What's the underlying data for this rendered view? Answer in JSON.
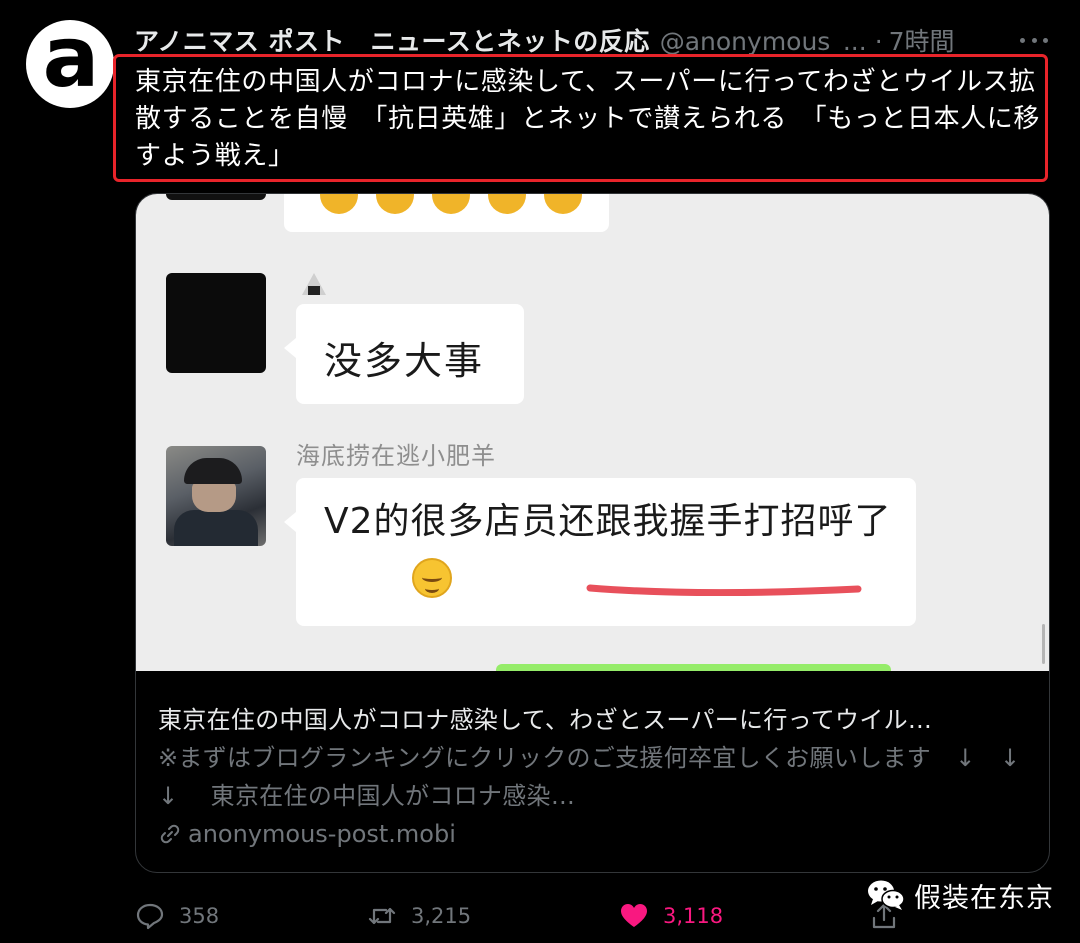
{
  "tweet": {
    "avatar_glyph": "a",
    "display_name": "アノニマス ポスト　ニュースとネットの反応",
    "handle": "@anonymous_...",
    "dot": "·",
    "time": "7時間",
    "text": "東京在住の中国人がコロナに感染して、スーパーに行ってわざとウイルス拡散することを自慢　「抗日英雄」とネットで讃えられる　「もっと日本人に移すよう戦え」",
    "highlight_color": "#e8242a"
  },
  "media": {
    "chat": {
      "message_1": "没多大事",
      "sender_name": "海底捞在逃小肥羊",
      "message_2": "V2的很多店员还跟我握手打招呼了"
    }
  },
  "link_card": {
    "title": "東京在住の中国人がコロナ感染して、わざとスーパーに行ってウイル…",
    "description": "※まずはブログランキングにクリックのご支援何卒宜しくお願いします　↓　↓　↓　 東京在住の中国人がコロナ感染…",
    "domain": "anonymous-post.mobi"
  },
  "actions": {
    "reply_count": "358",
    "retweet_count": "3,215",
    "like_count": "3,118",
    "like_color": "#f91880"
  },
  "watermark": {
    "text": "假装在东京",
    "icon": "wechat-icon"
  }
}
